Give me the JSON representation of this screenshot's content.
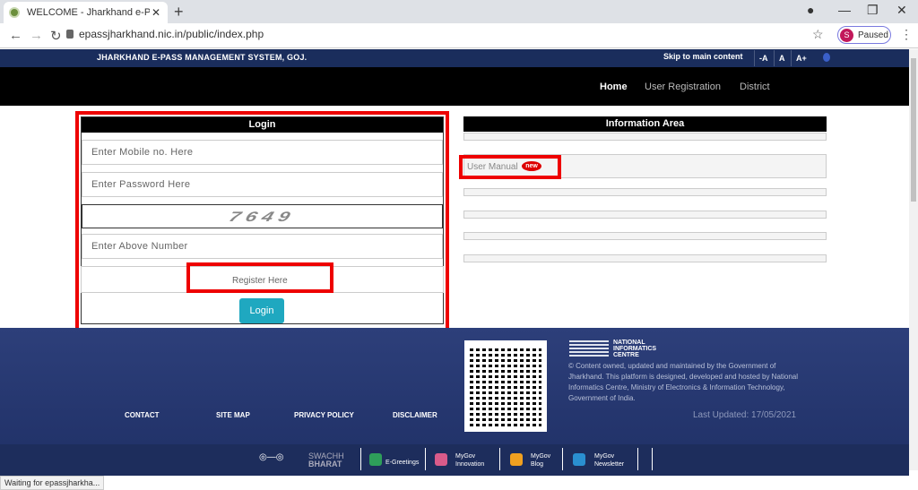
{
  "browser": {
    "tab_title": "WELCOME - Jharkhand e-Pass M",
    "url": "epassjharkhand.nic.in/public/index.php",
    "profile_initial": "S",
    "profile_status": "Paused",
    "status_text": "Waiting for epassjharkha..."
  },
  "header": {
    "site_name": "JHARKHAND E-PASS MANAGEMENT SYSTEM, GOJ.",
    "skip_link": "Skip to main content",
    "font_decrease": "-A",
    "font_normal": "A",
    "font_increase": "A+"
  },
  "nav": {
    "items": [
      "Home",
      "User Registration",
      "District"
    ]
  },
  "login": {
    "title": "Login",
    "mobile_placeholder": "Enter Mobile no. Here",
    "password_placeholder": "Enter Password Here",
    "captcha": "7649",
    "captcha_placeholder": "Enter Above Number",
    "register_label": "Register Here",
    "login_button": "Login"
  },
  "info": {
    "title": "Information Area",
    "user_manual": "User Manual",
    "new_badge": "new"
  },
  "footer": {
    "links": [
      "CONTACT",
      "SITE MAP",
      "PRIVACY POLICY",
      "DISCLAIMER"
    ],
    "nic_line1": "NATIONAL",
    "nic_line2": "INFORMATICS",
    "nic_line3": "CENTRE",
    "nic_desc": "© Content owned, updated and maintained by the Government of Jharkhand. This platform is designed, developed and hosted by National Informatics Centre, Ministry of Electronics & Information Technology, Government of India.",
    "last_updated": "Last Updated: 17/05/2021",
    "swachh": "SWACHH",
    "bharat": "BHARAT",
    "egreetings": "E-Greetings",
    "mygov_innovation_1": "MyGov",
    "mygov_innovation_2": "Innovation",
    "mygov_blog_1": "MyGov",
    "mygov_blog_2": "Blog",
    "mygov_news_1": "MyGov",
    "mygov_news_2": "Newsletter"
  },
  "colors": {
    "highlight": "#ee0000",
    "login_button": "#1fa8c0",
    "header_strip": "#1a2d5c"
  }
}
